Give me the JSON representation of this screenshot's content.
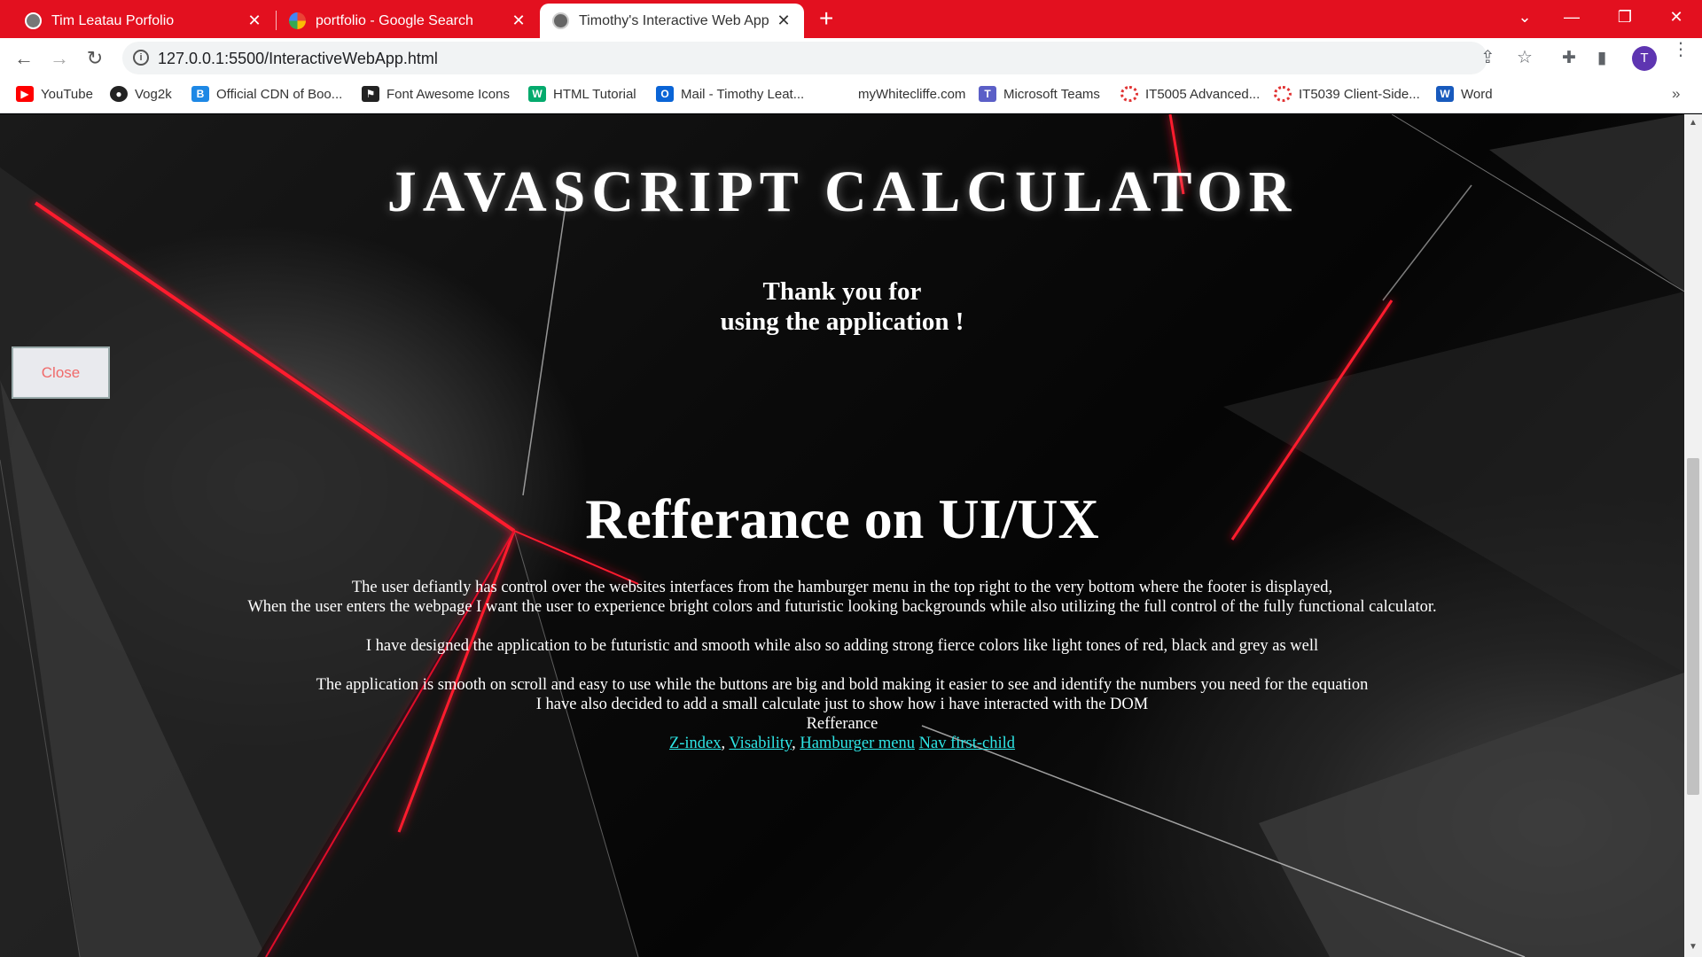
{
  "tabs": [
    {
      "title": "Tim Leatau Porfolio",
      "close": "✕"
    },
    {
      "title": "portfolio - Google Search",
      "close": "✕"
    },
    {
      "title": "Timothy's Interactive Web App",
      "close": "✕"
    }
  ],
  "new_tab": "+",
  "window_controls": {
    "tab_search": "⌄",
    "minimize": "—",
    "restore": "❐",
    "close": "✕"
  },
  "nav": {
    "back": "←",
    "forward": "→",
    "reload": "↻"
  },
  "address_bar": {
    "url": "127.0.0.1:5500/InteractiveWebApp.html",
    "info": "i"
  },
  "toolbar_icons": {
    "share": "⇪",
    "star": "☆",
    "extensions": "✚",
    "sidepanel": "▮",
    "profile_initial": "T",
    "menu": "⋮"
  },
  "bookmarks": [
    {
      "label": "YouTube",
      "icon": "youtube-icon",
      "color": "#ff0000"
    },
    {
      "label": "Vog2k",
      "icon": "github-icon",
      "color": "#222222"
    },
    {
      "label": "Official CDN of Boo...",
      "icon": "bootstrap-icon",
      "color": "#1e88e5"
    },
    {
      "label": "Font Awesome Icons",
      "icon": "fontawesome-icon",
      "color": "#222222"
    },
    {
      "label": "HTML Tutorial",
      "icon": "w3schools-icon",
      "color": "#04aa6d"
    },
    {
      "label": "Mail - Timothy Leat...",
      "icon": "outlook-icon",
      "color": "#0a64d6"
    },
    {
      "label": "myWhitecliffe.com",
      "icon": "",
      "color": ""
    },
    {
      "label": "Microsoft Teams",
      "icon": "teams-icon",
      "color": "#5b5fc7"
    },
    {
      "label": "IT5005 Advanced...",
      "icon": "canvas-icon",
      "color": "#e13333"
    },
    {
      "label": "IT5039 Client-Side...",
      "icon": "canvas-icon",
      "color": "#e13333"
    },
    {
      "label": "Word",
      "icon": "word-icon",
      "color": "#185abd"
    }
  ],
  "bookmarks_more": "»",
  "page": {
    "title": "JAVASCRIPT CALCULATOR",
    "thanks_line1": "Thank you for",
    "thanks_line2": "using the application !",
    "close_button": "Close",
    "ref_heading": "Refferance on UI/UX",
    "paragraphs": [
      "The user defiantly has control over the websites interfaces from the hamburger menu in the top right to the very bottom where the footer is displayed,",
      "When the user enters the webpage I want the user to experience bright colors and futuristic looking backgrounds while also utilizing the full control of the fully functional calculator.",
      "I have designed the application to be futuristic and smooth while also so adding strong fierce colors like light tones of red, black and grey as well",
      "The application is smooth on scroll and easy to use while the buttons are big and bold making it easier to see and identify the numbers you need for the equation",
      "I have also decided to add a small calculate just to show how i have interacted with the DOM",
      "Refferance"
    ],
    "links": [
      "Z-index",
      "Visability",
      "Hamburger menu",
      "Nav first-child"
    ],
    "link_separators": [
      ", ",
      ", ",
      " "
    ]
  },
  "colors": {
    "tab_strip": "#e3101f",
    "link": "#2ee6e6",
    "close_text": "#f06a6a",
    "accent_red": "#ff1a2e"
  }
}
